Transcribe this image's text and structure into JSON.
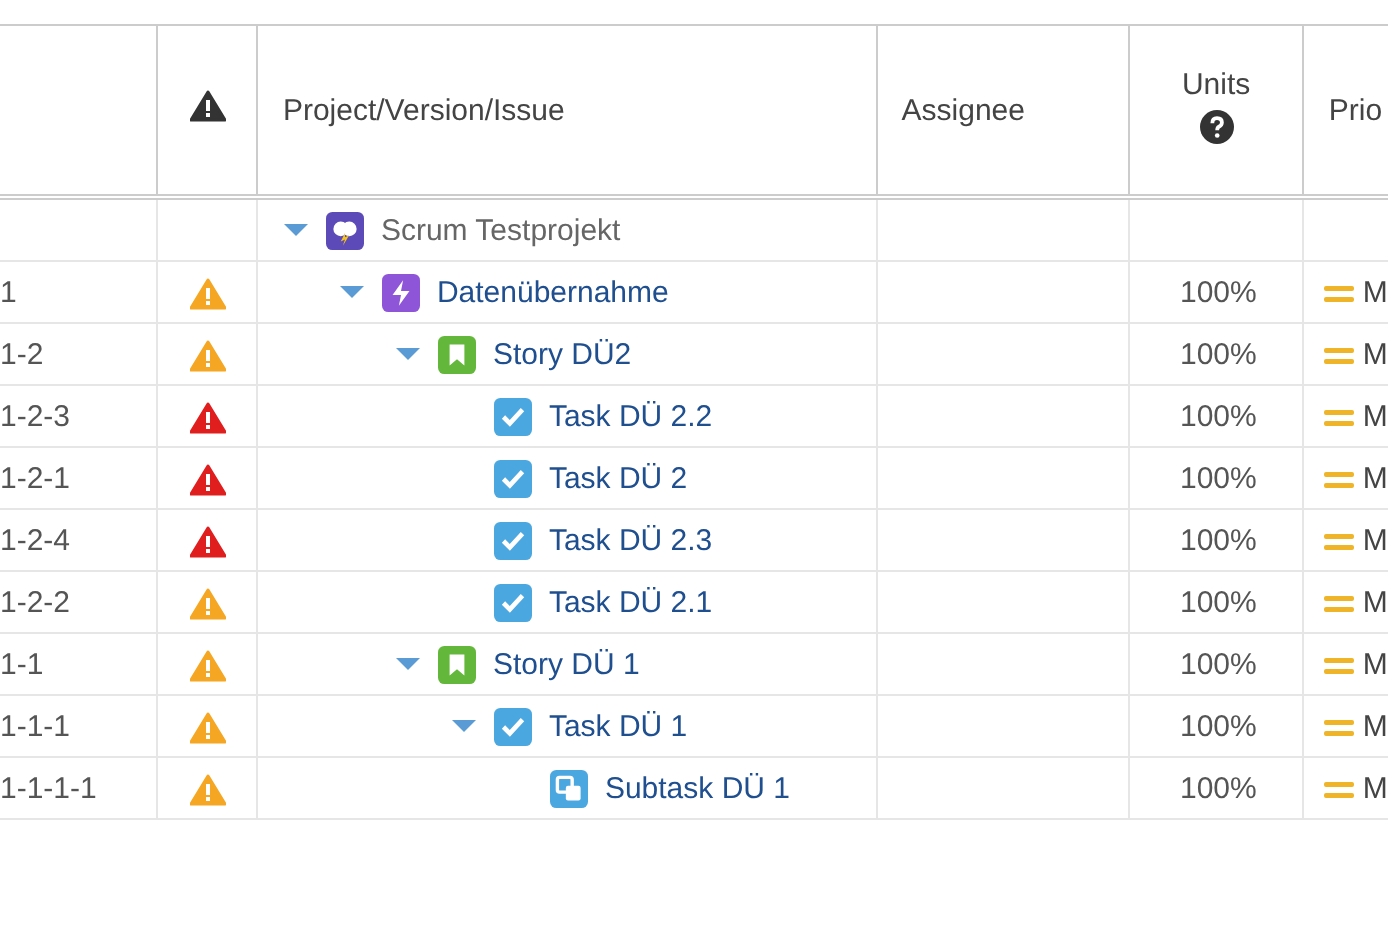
{
  "table": {
    "columns": [
      {
        "kind": "id"
      },
      {
        "kind": "alert-icon"
      },
      {
        "kind": "text",
        "label": "Project/Version/Issue"
      },
      {
        "kind": "text",
        "label": "Assignee"
      },
      {
        "kind": "help",
        "label": "Units"
      },
      {
        "kind": "text",
        "label": "Prio"
      }
    ],
    "rows": [
      {
        "kind": "project",
        "title": "Scrum Testprojekt",
        "expanded": true,
        "children": [
          {
            "id": "1",
            "color": "#f5a623",
            "kind": "epic",
            "title": "Datenübernahme",
            "units": "100%",
            "priority": "M",
            "expanded": true,
            "children": [
              {
                "id": "1-2",
                "color": "#f5a623",
                "kind": "story",
                "title": "Story DÜ2",
                "units": "100%",
                "priority": "M",
                "expanded": true,
                "children": [
                  {
                    "id": "1-2-3",
                    "color": "#e01e1e",
                    "kind": "task",
                    "title": "Task DÜ 2.2",
                    "units": "100%",
                    "priority": "M"
                  },
                  {
                    "id": "1-2-1",
                    "color": "#e01e1e",
                    "kind": "task",
                    "title": "Task DÜ 2",
                    "units": "100%",
                    "priority": "M"
                  },
                  {
                    "id": "1-2-4",
                    "color": "#e01e1e",
                    "kind": "task",
                    "title": "Task DÜ 2.3",
                    "units": "100%",
                    "priority": "M"
                  },
                  {
                    "id": "1-2-2",
                    "color": "#f5a623",
                    "kind": "task",
                    "title": "Task DÜ 2.1",
                    "units": "100%",
                    "priority": "M"
                  }
                ]
              },
              {
                "id": "1-1",
                "color": "#f5a623",
                "kind": "story",
                "title": "Story DÜ 1",
                "units": "100%",
                "priority": "M",
                "expanded": true,
                "children": [
                  {
                    "id": "1-1-1",
                    "color": "#f5a623",
                    "kind": "task",
                    "title": "Task DÜ 1",
                    "units": "100%",
                    "priority": "M",
                    "expanded": true,
                    "children": [
                      {
                        "id": "1-1-1-1",
                        "color": "#f5a623",
                        "kind": "subtask",
                        "title": "Subtask DÜ 1",
                        "units": "100%",
                        "priority": "M"
                      }
                    ]
                  }
                ]
              }
            ]
          }
        ]
      }
    ]
  }
}
